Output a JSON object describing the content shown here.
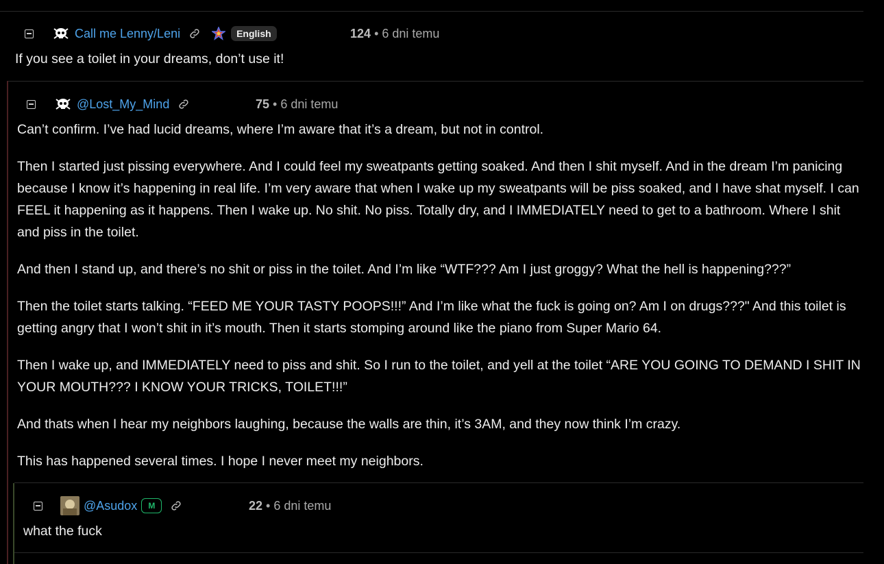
{
  "comments": [
    {
      "username": "Call me Lenny/Leni",
      "language": "English",
      "score": "124",
      "time": "• 6 dni temu",
      "body": [
        "If you see a toilet in your dreams, don’t use it!"
      ]
    },
    {
      "username": "@Lost_My_Mind",
      "score": "75",
      "time": "• 6 dni temu",
      "body": [
        "Can’t confirm. I’ve had lucid dreams, where I’m aware that it’s a dream, but not in control.",
        "Then I started just pissing everywhere. And I could feel my sweatpants getting soaked. And then I shit myself. And in the dream I’m panicing because I know it’s happening in real life. I’m very aware that when I wake up my sweatpants will be piss soaked, and I have shat myself. I can FEEL it happening as it happens. Then I wake up. No shit. No piss. Totally dry, and I IMMEDIATELY need to get to a bathroom. Where I shit and piss in the toilet.",
        "And then I stand up, and there’s no shit or piss in the toilet. And I’m like “WTF??? Am I just groggy? What the hell is happening???”",
        "Then the toilet starts talking. “FEED ME YOUR TASTY POOPS!!!” And I’m like what the fuck is going on? Am I on drugs???\" And this toilet is getting angry that I won’t shit in it’s mouth. Then it starts stomping around like the piano from Super Mario 64.",
        "Then I wake up, and IMMEDIATELY need to piss and shit. So I run to the toilet, and yell at the toilet “ARE YOU GOING TO DEMAND I SHIT IN YOUR MOUTH??? I KNOW YOUR TRICKS, TOILET!!!”",
        "And thats when I hear my neighbors laughing, because the walls are thin, it’s 3AM, and they now think I’m crazy.",
        "This has happened several times. I hope I never meet my neighbors."
      ]
    },
    {
      "username": "@Asudox",
      "badge": "M",
      "score": "22",
      "time": "• 6 dni temu",
      "body": [
        "what the fuck"
      ]
    }
  ],
  "colors": {
    "background": "#000000",
    "username": "#4ea3ea",
    "mod_badge": "#1fb86b",
    "text": "#ededed",
    "meta": "#a9a9a9"
  },
  "icons": [
    "collapse-icon",
    "skull-avatar-icon",
    "link-icon",
    "rainbow-star-icon",
    "user-photo-avatar"
  ]
}
